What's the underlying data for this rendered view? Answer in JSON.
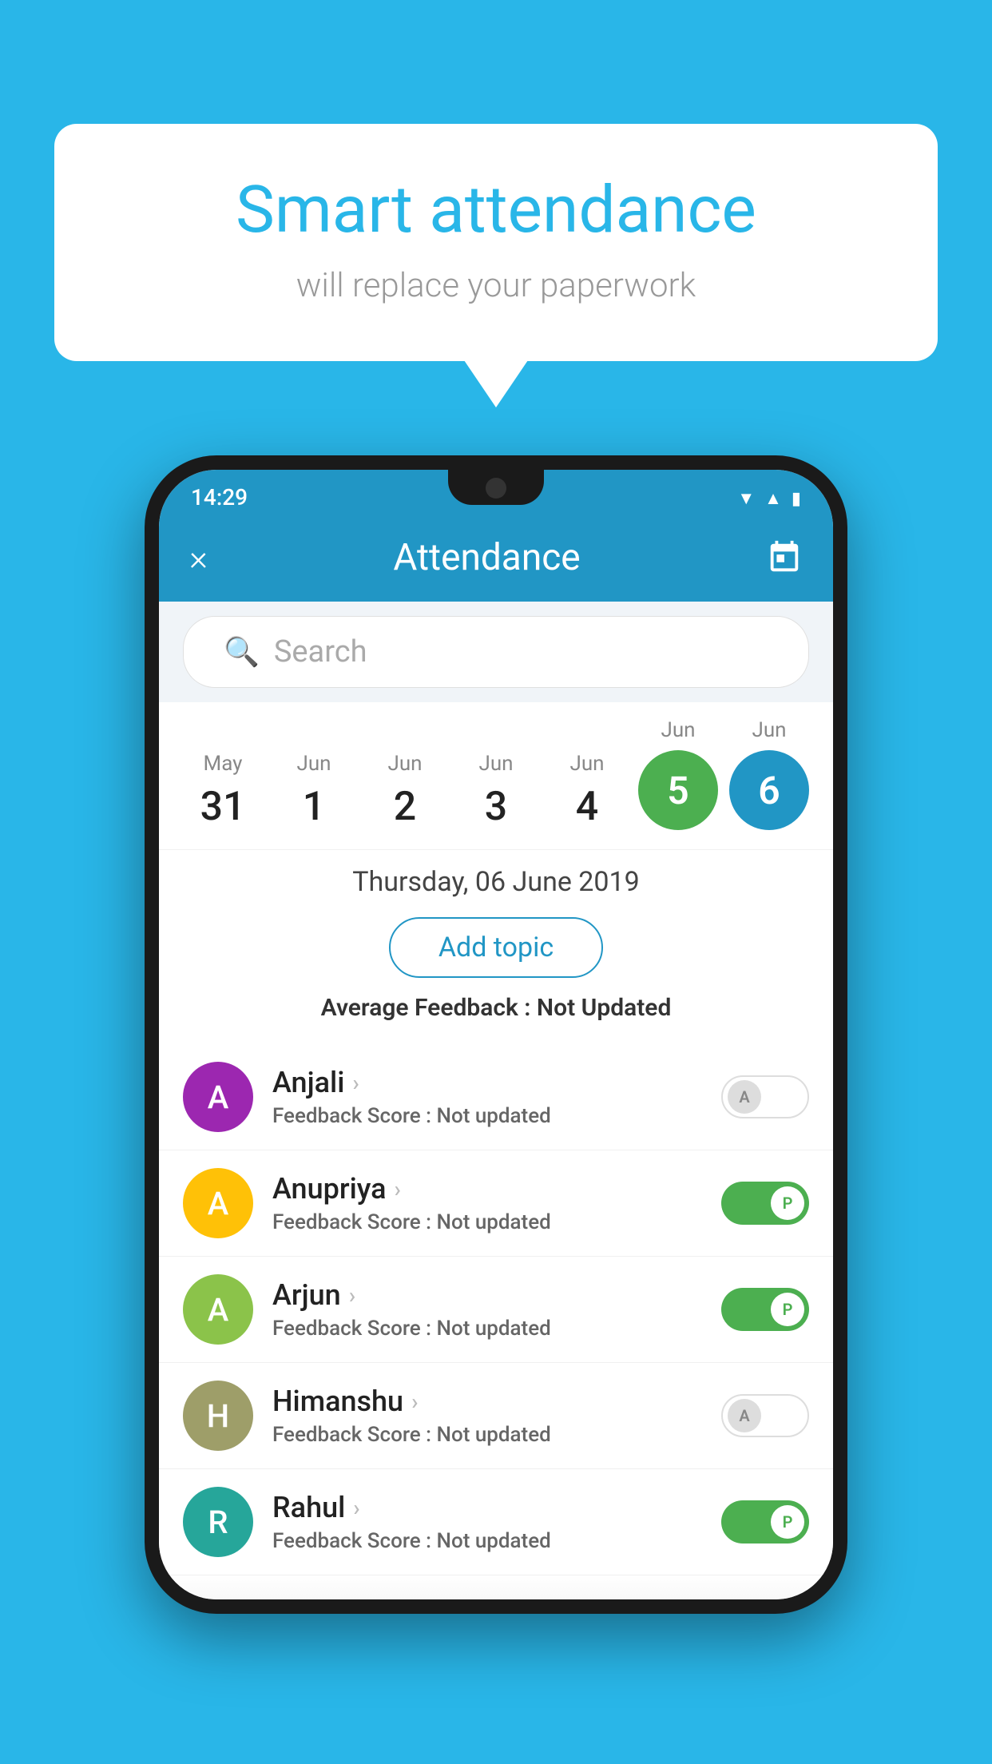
{
  "background_color": "#29B6E8",
  "bubble": {
    "title": "Smart attendance",
    "subtitle": "will replace your paperwork"
  },
  "status_bar": {
    "time": "14:29",
    "icons": [
      "wifi",
      "signal",
      "battery"
    ]
  },
  "header": {
    "title": "Attendance",
    "close_label": "×",
    "calendar_label": "calendar"
  },
  "search": {
    "placeholder": "Search"
  },
  "dates": [
    {
      "month": "May",
      "day": "31",
      "active": false,
      "today": false
    },
    {
      "month": "Jun",
      "day": "1",
      "active": false,
      "today": false
    },
    {
      "month": "Jun",
      "day": "2",
      "active": false,
      "today": false
    },
    {
      "month": "Jun",
      "day": "3",
      "active": false,
      "today": false
    },
    {
      "month": "Jun",
      "day": "4",
      "active": false,
      "today": false
    },
    {
      "month": "Jun",
      "day": "5",
      "active": true,
      "today": true,
      "color": "green"
    },
    {
      "month": "Jun",
      "day": "6",
      "active": true,
      "today": false,
      "color": "blue"
    }
  ],
  "selected_date": "Thursday, 06 June 2019",
  "add_topic_label": "Add topic",
  "avg_feedback_label": "Average Feedback :",
  "avg_feedback_value": "Not Updated",
  "students": [
    {
      "name": "Anjali",
      "avatar_letter": "A",
      "avatar_color": "purple",
      "feedback": "Not updated",
      "status": "absent"
    },
    {
      "name": "Anupriya",
      "avatar_letter": "A",
      "avatar_color": "yellow",
      "feedback": "Not updated",
      "status": "present"
    },
    {
      "name": "Arjun",
      "avatar_letter": "A",
      "avatar_color": "green",
      "feedback": "Not updated",
      "status": "present"
    },
    {
      "name": "Himanshu",
      "avatar_letter": "H",
      "avatar_color": "olive",
      "feedback": "Not updated",
      "status": "absent"
    },
    {
      "name": "Rahul",
      "avatar_letter": "R",
      "avatar_color": "teal",
      "feedback": "Not updated",
      "status": "present"
    }
  ],
  "feedback_score_label": "Feedback Score :"
}
